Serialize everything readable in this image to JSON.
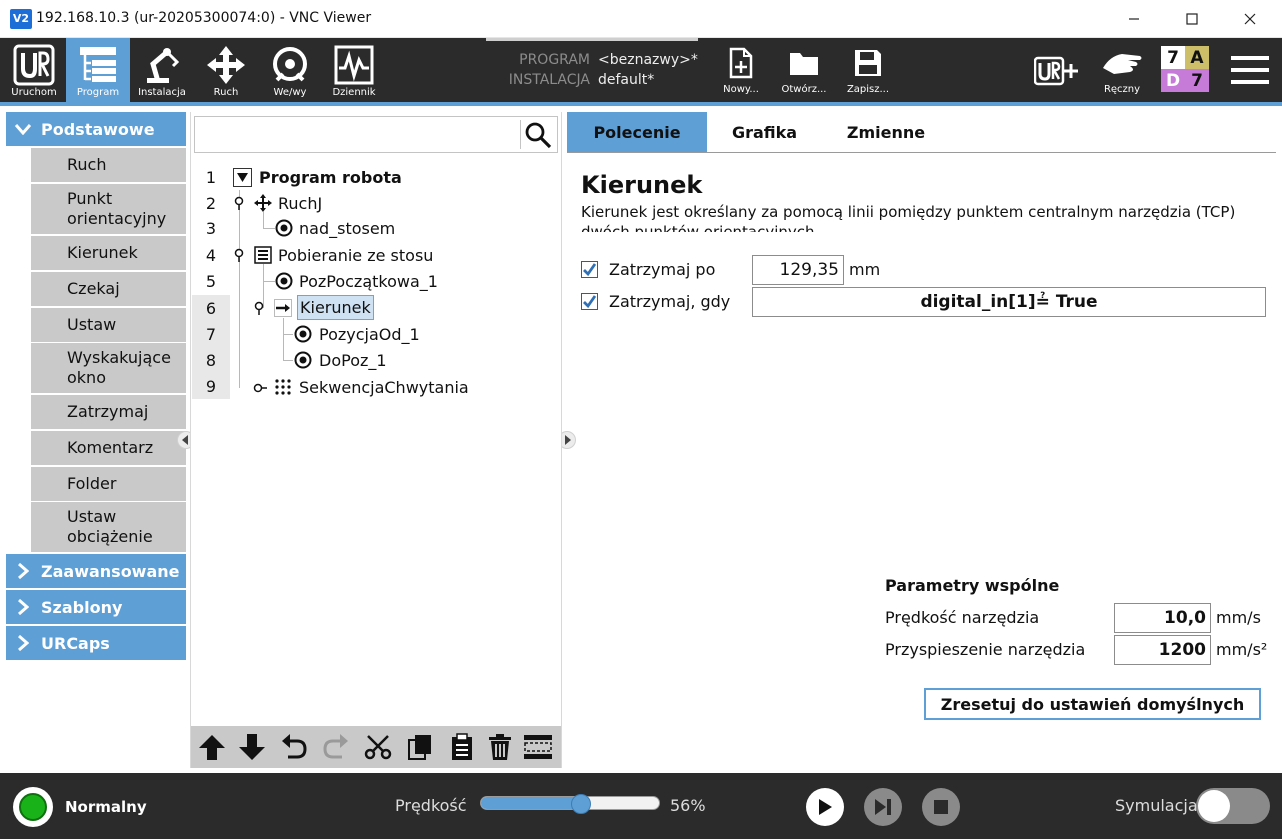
{
  "window": {
    "title": "192.168.10.3 (ur-20205300074:0) - VNC Viewer",
    "logo_text": "V2",
    "controls": [
      "minimize",
      "maximize",
      "close"
    ]
  },
  "toolbar": {
    "tabs": [
      {
        "label": "Uruchom",
        "icon": "ur-logo-icon"
      },
      {
        "label": "Program",
        "icon": "program-icon",
        "active": true
      },
      {
        "label": "Instalacja",
        "icon": "robot-arm-icon"
      },
      {
        "label": "Ruch",
        "icon": "move-arrows-icon"
      },
      {
        "label": "We/wy",
        "icon": "io-icon"
      },
      {
        "label": "Dziennik",
        "icon": "log-icon"
      }
    ],
    "program_label": "PROGRAM",
    "program_value": "<beznazwy>*",
    "installation_label": "INSTALACJA",
    "installation_value": "default*",
    "file_buttons": [
      {
        "label": "Nowy...",
        "icon": "new-file-icon"
      },
      {
        "label": "Otwórz...",
        "icon": "open-folder-icon"
      },
      {
        "label": "Zapisz...",
        "icon": "save-icon"
      }
    ],
    "manual_label": "Ręczny",
    "badges": {
      "top_left": "7",
      "top_right": "A",
      "bottom_left": "D",
      "bottom_right": "7"
    }
  },
  "library": {
    "categories": [
      {
        "label": "Podstawowe",
        "expanded": true
      },
      {
        "label": "Zaawansowane"
      },
      {
        "label": "Szablony"
      },
      {
        "label": "URCaps"
      }
    ],
    "basic_nodes": [
      "Ruch",
      "Punkt orientacyjny",
      "Kierunek",
      "Czekaj",
      "Ustaw",
      "Wyskakujące okno",
      "Zatrzymaj",
      "Komentarz",
      "Folder",
      "Ustaw obciążenie"
    ]
  },
  "tree": {
    "search_placeholder": "",
    "lines": [
      {
        "num": "1",
        "text": "Program robota"
      },
      {
        "num": "2",
        "text": "RuchJ"
      },
      {
        "num": "3",
        "text": "nad_stosem"
      },
      {
        "num": "4",
        "text": "Pobieranie ze stosu"
      },
      {
        "num": "5",
        "text": "PozPoczątkowa_1"
      },
      {
        "num": "6",
        "text": "Kierunek",
        "selected": true
      },
      {
        "num": "7",
        "text": "PozycjaOd_1"
      },
      {
        "num": "8",
        "text": "DoPoz_1"
      },
      {
        "num": "9",
        "text": "SekwencjaChwytania"
      }
    ],
    "toolbar_icons": [
      "move-up-icon",
      "move-down-icon",
      "undo-icon",
      "redo-icon",
      "cut-icon",
      "copy-icon",
      "paste-icon",
      "delete-icon",
      "suppress-icon"
    ]
  },
  "command": {
    "tabs": [
      "Polecenie",
      "Grafika",
      "Zmienne"
    ],
    "active_tab": "Polecenie",
    "title": "Kierunek",
    "description": "Kierunek jest określany za pomocą linii pomiędzy punktem centralnym narzędzia (TCP) dwóch punktów orientacyjnych",
    "stop_after_label": "Zatrzymaj po",
    "stop_after_checked": true,
    "stop_after_value": "129,35",
    "stop_after_unit": "mm",
    "stop_when_label": "Zatrzymaj, gdy",
    "stop_when_checked": true,
    "stop_when_value": "digital_in[1]≟ True",
    "shared_params_title": "Parametry wspólne",
    "tool_speed_label": "Prędkość narzędzia",
    "tool_speed_value": "10,0",
    "tool_speed_unit": "mm/s",
    "tool_accel_label": "Przyspieszenie narzędzia",
    "tool_accel_value": "1200",
    "tool_accel_unit": "mm/s²",
    "reset_label": "Zresetuj do ustawień domyślnych"
  },
  "status": {
    "state_label": "Normalny",
    "state_color": "#19b219",
    "speed_label": "Prędkość",
    "speed_value": "56%",
    "speed_fraction": 0.56,
    "simulation_label": "Symulacja",
    "simulation_on": false
  },
  "colors": {
    "accent": "#5e9fd6",
    "toolbar": "#2b2b2b",
    "library_item": "#c9c9c9"
  }
}
